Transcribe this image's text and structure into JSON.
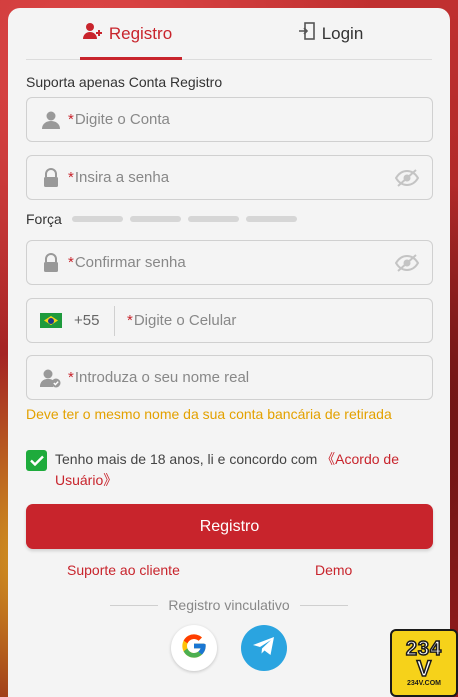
{
  "tabs": [
    {
      "label": "Registro",
      "icon": "add-user-icon",
      "active": true
    },
    {
      "label": "Login",
      "icon": "login-door-icon",
      "active": false
    }
  ],
  "form": {
    "section_label": "Suporta apenas Conta Registro",
    "account": {
      "required_mark": "*",
      "placeholder": "Digite o Conta",
      "icon": "user-icon"
    },
    "password": {
      "required_mark": "*",
      "placeholder": "Insira a senha",
      "icon": "lock-icon"
    },
    "strength_label": "Força",
    "strength_segments": 4,
    "confirm": {
      "required_mark": "*",
      "placeholder": "Confirmar senha",
      "icon": "lock-icon"
    },
    "phone": {
      "country_code": "+55",
      "required_mark": "*",
      "placeholder": "Digite o Celular",
      "flag": "brazil-flag-icon"
    },
    "realname": {
      "required_mark": "*",
      "placeholder": "Introduza o seu nome real",
      "icon": "user-check-icon"
    },
    "realname_hint": "Deve ter o mesmo nome da sua conta bancária de retirada",
    "agreement": {
      "checked": true,
      "text": "Tenho mais de 18 anos, li e concordo com ",
      "link_line1": "《Acordo de",
      "link_line2": "Usuário》"
    },
    "submit_label": "Registro"
  },
  "footer": {
    "support_link": "Suporte ao cliente",
    "demo_link": "Demo",
    "divider_label": "Registro vinculativo",
    "social": [
      "google-icon",
      "telegram-icon"
    ]
  },
  "logo": {
    "number": "234",
    "letter": "V",
    "domain": "234V.COM"
  },
  "colors": {
    "accent": "#c8242c",
    "hint": "#e3a100",
    "check": "#1eab3c",
    "telegram": "#2aa4e0"
  }
}
